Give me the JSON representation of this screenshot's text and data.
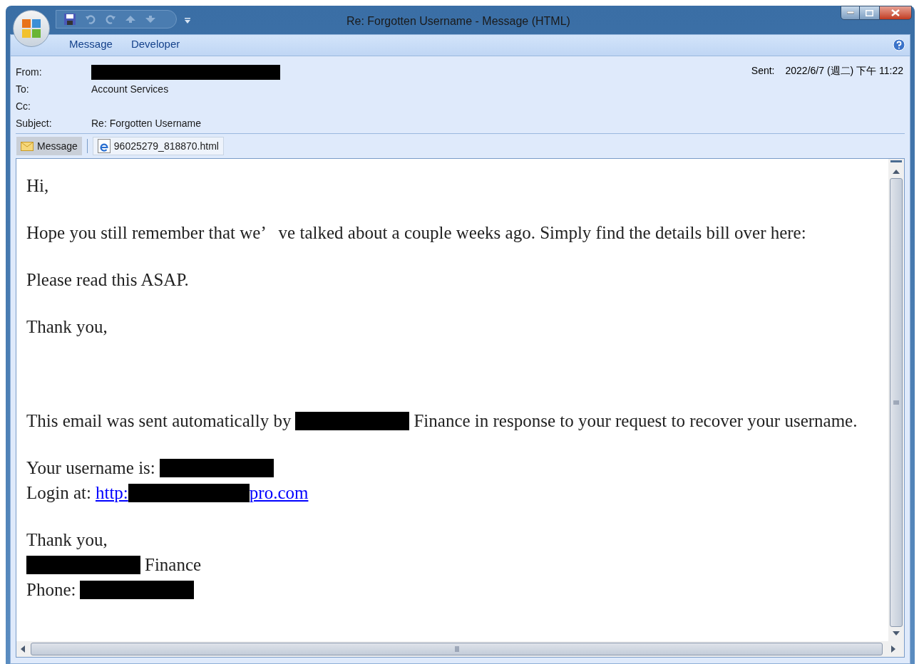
{
  "window": {
    "title": "Re: Forgotten Username - Message (HTML)"
  },
  "ribbon_tabs": [
    {
      "label": "Message"
    },
    {
      "label": "Developer"
    }
  ],
  "header": {
    "fields": [
      {
        "label": "From:",
        "kind": "redacted"
      },
      {
        "label": "To:",
        "kind": "text",
        "value": "Account Services"
      },
      {
        "label": "Cc:",
        "kind": "empty"
      },
      {
        "label": "Subject:",
        "kind": "text",
        "value": "Re: Forgotten Username"
      }
    ],
    "sent": {
      "label": "Sent:",
      "value": "2022/6/7 (週二) 下午 11:22"
    }
  },
  "attachments": [
    {
      "label": "Message",
      "kind": "message",
      "selected": true
    },
    {
      "label": "96025279_818870.html",
      "kind": "html",
      "selected": false
    }
  ],
  "body": {
    "sections": [
      {
        "paragraphs": [
          {
            "lines": [
              [
                {
                  "kind": "text",
                  "text": "Hi,"
                }
              ]
            ]
          },
          {
            "lines": [
              [
                {
                  "kind": "text",
                  "text": "Hope you still remember that we’   ve talked about a couple weeks ago. Simply find the details bill over here:"
                }
              ]
            ]
          },
          {
            "lines": [
              [
                {
                  "kind": "text",
                  "text": "Please read this ASAP."
                }
              ]
            ]
          },
          {
            "lines": [
              [
                {
                  "kind": "text",
                  "text": "Thank you,"
                }
              ]
            ]
          }
        ]
      },
      {
        "paragraphs": [
          {
            "lines": [
              [
                {
                  "kind": "text",
                  "text": "This email was sent automatically by"
                },
                {
                  "kind": "redacted"
                },
                {
                  "kind": "text",
                  "text": "Finance in response to your request to recover your username."
                }
              ]
            ]
          },
          {
            "lines": [
              [
                {
                  "kind": "text",
                  "text": "Your username is:"
                },
                {
                  "kind": "redacted"
                }
              ],
              [
                {
                  "kind": "text",
                  "text": "Login at:"
                },
                {
                  "kind": "link",
                  "before": "http:",
                  "after": "pro.com"
                }
              ]
            ]
          },
          {
            "lines": [
              [
                {
                  "kind": "text",
                  "text": "Thank you,"
                }
              ],
              [
                {
                  "kind": "redacted"
                },
                {
                  "kind": "text",
                  "text": "Finance"
                }
              ],
              [
                {
                  "kind": "text",
                  "text": "Phone:"
                },
                {
                  "kind": "redacted"
                }
              ]
            ]
          }
        ]
      }
    ]
  }
}
